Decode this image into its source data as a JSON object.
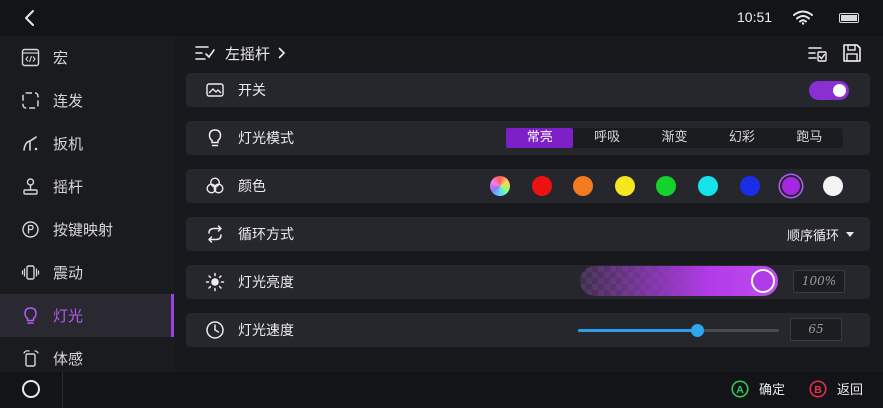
{
  "status_bar": {
    "time": "10:51"
  },
  "sidebar": {
    "items": [
      {
        "label": "宏",
        "icon": "macro-code-icon"
      },
      {
        "label": "连发",
        "icon": "repeat-fire-icon"
      },
      {
        "label": "扳机",
        "icon": "trigger-icon"
      },
      {
        "label": "摇杆",
        "icon": "joystick-icon"
      },
      {
        "label": "按键映射",
        "icon": "key-mapping-icon"
      },
      {
        "label": "震动",
        "icon": "vibration-icon"
      },
      {
        "label": "灯光",
        "icon": "bulb-icon",
        "active": true
      },
      {
        "label": "体感",
        "icon": "motion-sensing-icon"
      }
    ]
  },
  "header": {
    "breadcrumb": "左摇杆"
  },
  "settings": {
    "switch": {
      "label": "开关",
      "on": true
    },
    "light_mode": {
      "label": "灯光模式",
      "options": [
        "常亮",
        "呼吸",
        "渐变",
        "幻彩",
        "跑马"
      ],
      "selected": "常亮"
    },
    "color": {
      "label": "颜色",
      "swatches": [
        "rainbow",
        "#ee1111",
        "#f47a20",
        "#f5e620",
        "#14d22a",
        "#14e4ea",
        "#1a2ee8",
        "#a726e6",
        "#f4f4f4"
      ],
      "selected_index": 7
    },
    "loop": {
      "label": "循环方式",
      "value": "顺序循环"
    },
    "brightness": {
      "label": "灯光亮度",
      "value_text": "100%",
      "value": 100
    },
    "speed": {
      "label": "灯光速度",
      "value_text": "65",
      "value": 65,
      "max": 110
    }
  },
  "bottom_bar": {
    "confirm": {
      "button": "A",
      "label": "确定"
    },
    "back": {
      "button": "B",
      "label": "返回"
    }
  },
  "colors": {
    "accent": "#8a2fd1",
    "active_text": "#b45cf0",
    "slider_blue": "#2b9fe6",
    "confirm_green": "#2fcf5a",
    "back_red": "#e8304a"
  }
}
